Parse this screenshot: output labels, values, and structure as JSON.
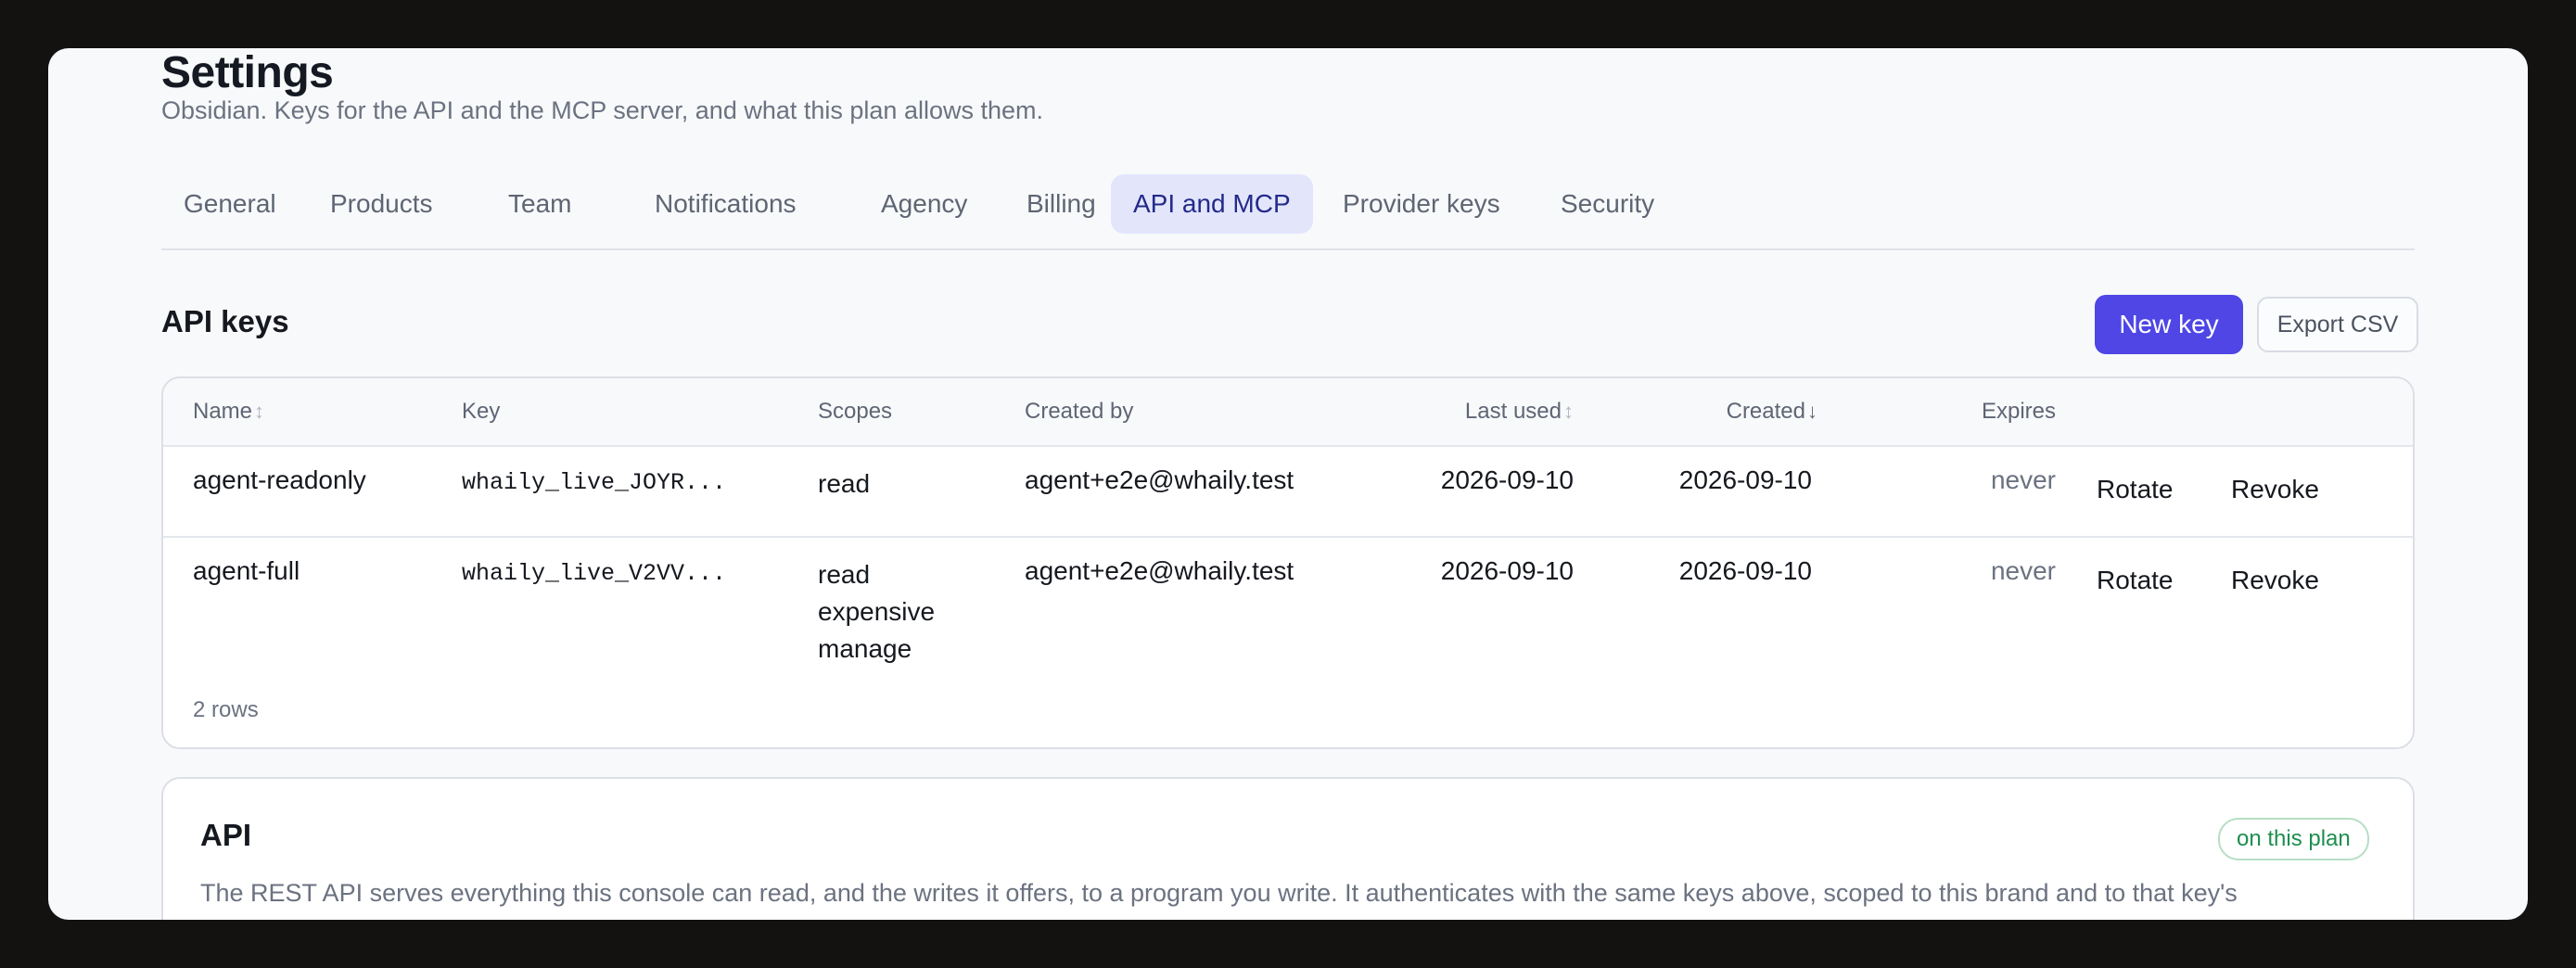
{
  "header": {
    "title": "Settings",
    "subtitle": "Obsidian. Keys for the API and the MCP server, and what this plan allows them."
  },
  "tabs": [
    {
      "label": "General"
    },
    {
      "label": "Products"
    },
    {
      "label": "Team"
    },
    {
      "label": "Notifications"
    },
    {
      "label": "Agency"
    },
    {
      "label": "Billing"
    },
    {
      "label": "API and MCP",
      "active": true
    },
    {
      "label": "Provider keys"
    },
    {
      "label": "Security"
    }
  ],
  "api_keys": {
    "title": "API keys",
    "new_key_label": "New key",
    "export_label": "Export CSV",
    "columns": {
      "name": "Name",
      "key": "Key",
      "scopes": "Scopes",
      "created_by": "Created by",
      "last_used": "Last used",
      "created": "Created",
      "expires": "Expires"
    },
    "sort_icons": {
      "neutral": "↕",
      "desc": "↓"
    },
    "rows": [
      {
        "name": "agent-readonly",
        "key": "whaily_live_JOYR...",
        "scopes": [
          "read"
        ],
        "created_by": "agent+e2e@whaily.test",
        "last_used": "2026-09-10",
        "created": "2026-09-10",
        "expires": "never",
        "rotate_label": "Rotate",
        "revoke_label": "Revoke"
      },
      {
        "name": "agent-full",
        "key": "whaily_live_V2VV...",
        "scopes": [
          "read",
          "expensive",
          "manage"
        ],
        "created_by": "agent+e2e@whaily.test",
        "last_used": "2026-09-10",
        "created": "2026-09-10",
        "expires": "never",
        "rotate_label": "Rotate",
        "revoke_label": "Revoke"
      }
    ],
    "row_count": "2 rows"
  },
  "api_section": {
    "title": "API",
    "badge": "on this plan",
    "description": "The REST API serves everything this console can read, and the writes it offers, to a program you write. It authenticates with the same keys above, scoped to this brand and to that key's"
  },
  "colors": {
    "accent": "#4f46e5",
    "active_tab_bg": "#e3e6fb",
    "badge_green": "#1e8e4f",
    "backdrop": "#141210"
  }
}
